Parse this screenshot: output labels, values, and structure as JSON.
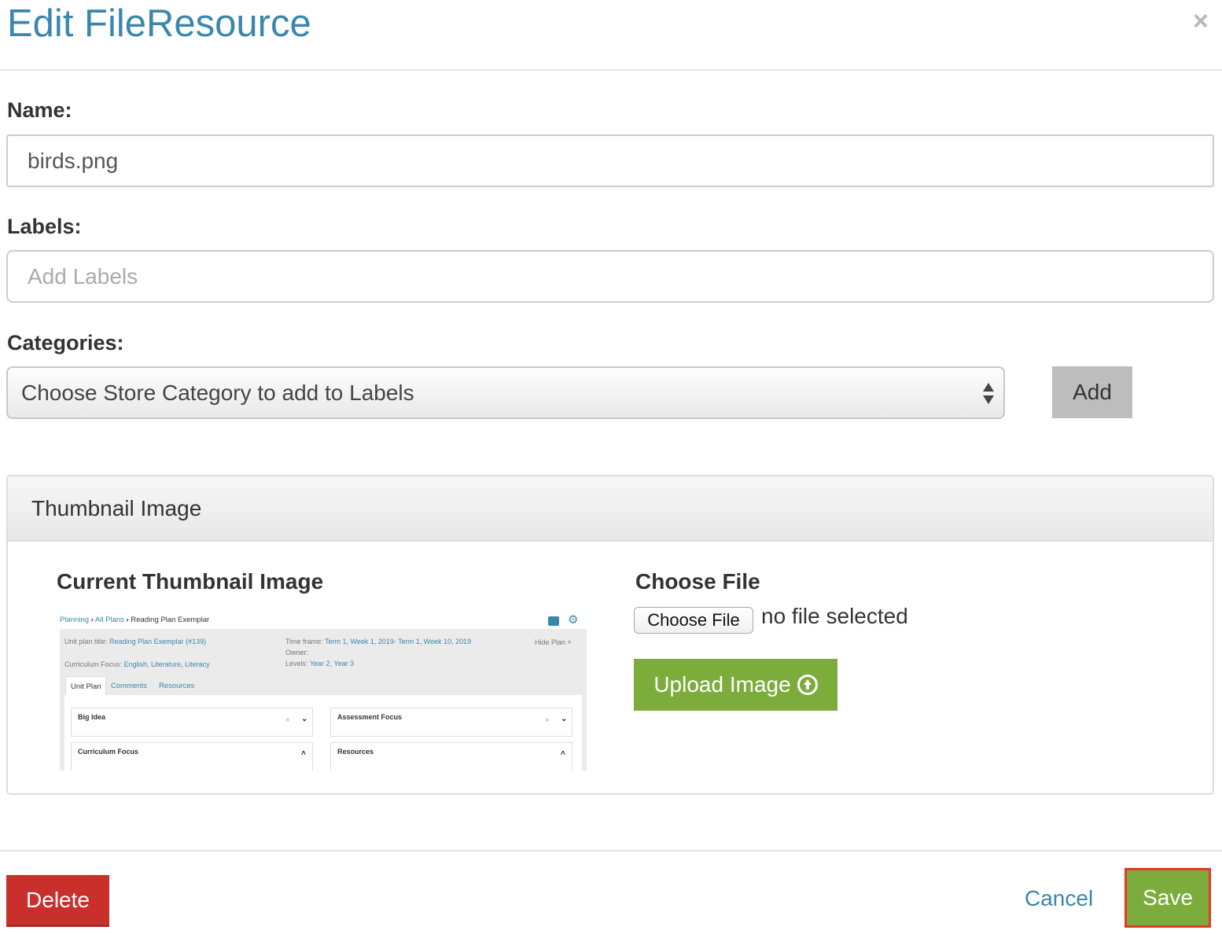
{
  "modal": {
    "title": "Edit FileResource",
    "close_glyph": "×"
  },
  "form": {
    "name_label": "Name:",
    "name_value": "birds.png",
    "labels_label": "Labels:",
    "labels_placeholder": "Add Labels",
    "categories_label": "Categories:",
    "categories_selected": "Choose Store Category to add to Labels",
    "add_button": "Add"
  },
  "thumbnail_panel": {
    "title": "Thumbnail Image",
    "current_heading": "Current Thumbnail Image",
    "choose_heading": "Choose File",
    "choose_button": "Choose File",
    "no_file_text": "no file selected",
    "upload_button": "Upload Image",
    "preview": {
      "crumb_1": "Planning",
      "crumb_2": "All Plans",
      "crumb_3": "Reading Plan Exemplar",
      "unit_title_label": "Unit plan title:",
      "unit_title_value": "Reading Plan Exemplar (#139)",
      "focus_label": "Curriculum Focus:",
      "focus_value": "English, Literature, Literacy",
      "time_label": "Time frame:",
      "time_value": "Term 1, Week 1, 2019- Term 1, Week 10, 2019",
      "owner_label": "Owner:",
      "levels_label": "Levels:",
      "levels_value": "Year 2, Year 3",
      "hide_plan": "Hide Plan",
      "tab_unit_plan": "Unit Plan",
      "tab_comments": "Comments",
      "tab_resources": "Resources",
      "card_big_idea": "Big Idea",
      "card_assessment": "Assessment Focus",
      "card_curriculum": "Curriculum Focus",
      "card_resources": "Resources"
    }
  },
  "footer": {
    "delete_button": "Delete",
    "cancel_link": "Cancel",
    "save_button": "Save"
  },
  "colors": {
    "title_blue": "#3a87ad",
    "primary_green": "#7cac3c",
    "danger_red": "#c9302c",
    "highlight_outline": "#e03b24"
  }
}
